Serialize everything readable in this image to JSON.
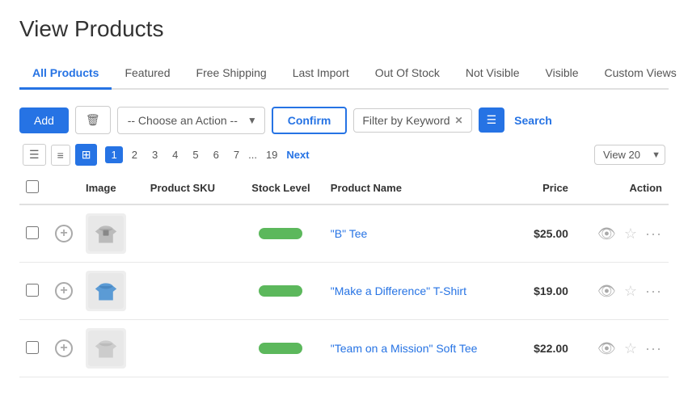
{
  "page": {
    "title": "View Products"
  },
  "tabs": [
    {
      "label": "All Products",
      "active": true
    },
    {
      "label": "Featured",
      "active": false
    },
    {
      "label": "Free Shipping",
      "active": false
    },
    {
      "label": "Last Import",
      "active": false
    },
    {
      "label": "Out Of Stock",
      "active": false
    },
    {
      "label": "Not Visible",
      "active": false
    },
    {
      "label": "Visible",
      "active": false
    },
    {
      "label": "Custom Views",
      "active": false
    }
  ],
  "toolbar": {
    "add_label": "Add",
    "confirm_label": "Confirm",
    "search_label": "Search",
    "action_placeholder": "-- Choose an Action --",
    "filter_keyword": "Filter by Keyword"
  },
  "pagination": {
    "pages": [
      "1",
      "2",
      "3",
      "4",
      "5",
      "6",
      "7"
    ],
    "ellipsis": "...",
    "last_page": "19",
    "next_label": "Next",
    "view_label": "View 20"
  },
  "table": {
    "columns": [
      "",
      "",
      "Image",
      "Product SKU",
      "Stock Level",
      "Product Name",
      "Price",
      "Action"
    ],
    "rows": [
      {
        "sku": "",
        "product_name": "\"B\" Tee",
        "price": "$25.00",
        "stock": "green"
      },
      {
        "sku": "",
        "product_name": "\"Make a Difference\" T-Shirt",
        "price": "$19.00",
        "stock": "green"
      },
      {
        "sku": "",
        "product_name": "\"Team on a Mission\" Soft Tee",
        "price": "$22.00",
        "stock": "green"
      }
    ]
  }
}
